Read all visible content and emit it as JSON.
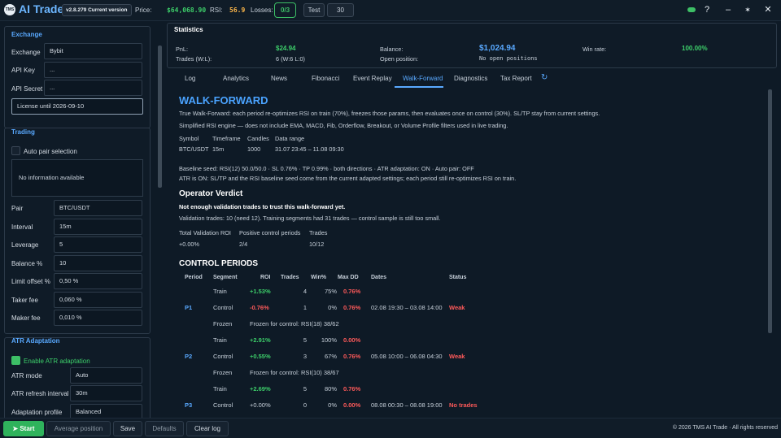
{
  "header": {
    "logo_text": "TMS",
    "title": "AI Trade",
    "version": "v2.8.279 Current version",
    "price_label": "Price:",
    "price_value": "$64,068.90",
    "rsi_label": "RSI:",
    "rsi_value": "56.9",
    "losses_label": "Losses:",
    "losses_value": "0/3",
    "test_button": "Test",
    "test_count": "30",
    "help_icon": "?",
    "min_icon": "–",
    "settings_icon": "✶",
    "close_icon": "✕",
    "colors": {
      "accent": "#59a9ff",
      "green": "#3dbf66",
      "red": "#ff5a5a",
      "price": "#3dcf6a",
      "rsi": "#ffb84a"
    }
  },
  "exchange": {
    "title": "Exchange",
    "exchange_label": "Exchange",
    "exchange_value": "Bybit",
    "api_key_label": "API Key",
    "api_key_value": "...",
    "api_secret_label": "API Secret",
    "api_secret_value": "...",
    "license": "License until 2026-09-10"
  },
  "trading": {
    "title": "Trading",
    "auto_pair_label": "Auto pair selection",
    "info": "No information available",
    "pair_label": "Pair",
    "pair_value": "BTC/USDT",
    "interval_label": "Interval",
    "interval_value": "15m",
    "leverage_label": "Leverage",
    "leverage_value": "5",
    "balance_label": "Balance %",
    "balance_value": "10",
    "limit_label": "Limit offset %",
    "limit_value": "0,50 %",
    "taker_label": "Taker fee",
    "taker_value": "0,060 %",
    "maker_label": "Maker fee",
    "maker_value": "0,010 %"
  },
  "atr": {
    "title": "ATR Adaptation",
    "enable_label": "Enable ATR adaptation",
    "mode_label": "ATR mode",
    "mode_value": "Auto",
    "refresh_label": "ATR refresh interval",
    "refresh_value": "30m",
    "profile_label": "Adaptation profile",
    "profile_value": "Balanced"
  },
  "statistics": {
    "title": "Statistics",
    "pnl_label": "PnL:",
    "pnl_value": "$24.94",
    "trades_label": "Trades (W:L):",
    "trades_value": "6 (W:6 L:0)",
    "balance_label": "Balance:",
    "balance_value": "$1,024.94",
    "open_label": "Open position:",
    "open_value": "No open positions",
    "winrate_label": "Win rate:",
    "winrate_value": "100.00%"
  },
  "tabs": [
    "Log",
    "Analytics",
    "News",
    "Fibonacci",
    "Event Replay",
    "Walk-Forward",
    "Diagnostics",
    "Tax Report"
  ],
  "refresh_icon": "↻",
  "walkforward": {
    "title": "WALK-FORWARD",
    "intro": "True Walk-Forward: each period re-optimizes RSI on train (70%), freezes those params, then evaluates once on control (30%). SL/TP stay from current settings.",
    "note": "Simplified RSI engine — does not include EMA, MACD, Fib, Orderflow, Breakout, or Volume Profile filters used in live trading.",
    "meta_headers": [
      "Symbol",
      "Timeframe",
      "Candles",
      "Data range"
    ],
    "meta_values": [
      "BTC/USDT",
      "15m",
      "1000",
      "31.07 23:45 – 11.08 09:30"
    ],
    "baseline": "Baseline seed: RSI(12) 50.0/50.0 · SL 0.76% · TP 0.99% · both directions · ATR adaptation: ON · Auto pair: OFF",
    "atr_note": "ATR is ON: SL/TP and the RSI baseline seed come from the current adapted settings; each period still re-optimizes RSI on train.",
    "verdict_title": "Operator Verdict",
    "verdict_bold": "Not enough validation trades to trust this walk-forward yet.",
    "verdict_text": "Validation trades: 10 (need 12). Training segments had 31 trades — control sample is still too small.",
    "summary_headers": [
      "Total Validation ROI",
      "Positive control periods",
      "Trades"
    ],
    "summary_values": [
      "+0.00%",
      "2/4",
      "10/12"
    ],
    "control_title": "CONTROL PERIODS",
    "col_headers": [
      "Period",
      "Segment",
      "ROI",
      "Trades",
      "Win%",
      "Max DD",
      "Dates",
      "Status"
    ],
    "rows": [
      {
        "period": "",
        "segment": "Train",
        "roi": "+1.53%",
        "trades": "4",
        "win": "75%",
        "dd": "0.76%",
        "dates": "",
        "status": "",
        "roi_color": "green",
        "dd_color": "red",
        "status_color": ""
      },
      {
        "period": "P1",
        "segment": "Control",
        "roi": "-0.76%",
        "trades": "1",
        "win": "0%",
        "dd": "0.76%",
        "dates": "02.08 19:30 – 03.08 14:00",
        "status": "Weak",
        "roi_color": "red",
        "dd_color": "red",
        "status_color": "red"
      },
      {
        "period": "",
        "segment": "Frozen",
        "frozen": "Frozen for control: RSI(18) 38/62"
      },
      {
        "period": "",
        "segment": "Train",
        "roi": "+2.91%",
        "trades": "5",
        "win": "100%",
        "dd": "0.00%",
        "dates": "",
        "status": "",
        "roi_color": "green",
        "dd_color": "red",
        "status_color": ""
      },
      {
        "period": "P2",
        "segment": "Control",
        "roi": "+0.55%",
        "trades": "3",
        "win": "67%",
        "dd": "0.76%",
        "dates": "05.08 10:00 – 06.08 04:30",
        "status": "Weak",
        "roi_color": "green",
        "dd_color": "red",
        "status_color": "red"
      },
      {
        "period": "",
        "segment": "Frozen",
        "frozen": "Frozen for control: RSI(10) 38/67"
      },
      {
        "period": "",
        "segment": "Train",
        "roi": "+2.69%",
        "trades": "5",
        "win": "80%",
        "dd": "0.76%",
        "dates": "",
        "status": "",
        "roi_color": "green",
        "dd_color": "red",
        "status_color": ""
      },
      {
        "period": "P3",
        "segment": "Control",
        "roi": "+0.00%",
        "trades": "0",
        "win": "0%",
        "dd": "0.00%",
        "dates": "08.08 00:30 – 08.08 19:00",
        "status": "No trades",
        "roi_color": "grey",
        "dd_color": "red",
        "status_color": "red"
      }
    ]
  },
  "bottom": {
    "start": "➤ Start",
    "average": "Average position",
    "save": "Save",
    "defaults": "Defaults",
    "clear": "Clear log",
    "copyright": "© 2026 TMS AI Trade · All rights reserved"
  }
}
